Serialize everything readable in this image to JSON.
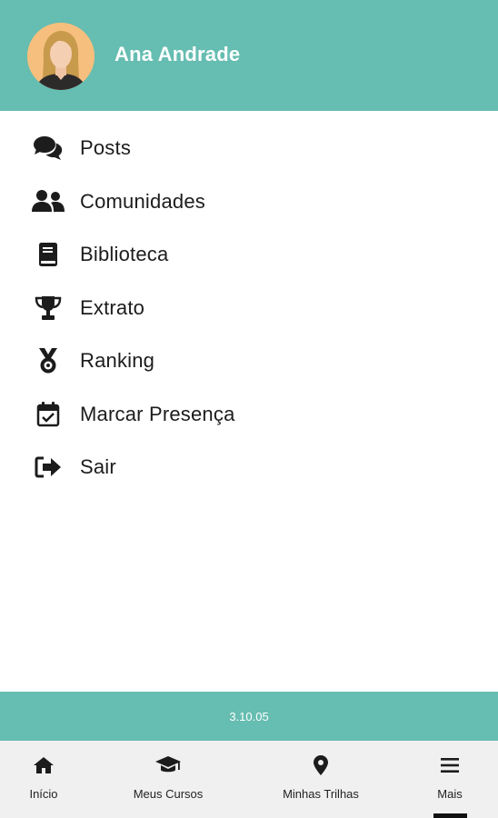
{
  "header": {
    "user_name": "Ana Andrade",
    "avatar_icon": "user-avatar",
    "background_color": "#66bdb1"
  },
  "menu": {
    "items": [
      {
        "label": "Posts",
        "icon": "comments-icon"
      },
      {
        "label": "Comunidades",
        "icon": "users-icon"
      },
      {
        "label": "Biblioteca",
        "icon": "book-icon"
      },
      {
        "label": "Extrato",
        "icon": "trophy-icon"
      },
      {
        "label": "Ranking",
        "icon": "medal-icon"
      },
      {
        "label": "Marcar Presença",
        "icon": "calendar-check-icon"
      },
      {
        "label": "Sair",
        "icon": "sign-out-icon"
      }
    ]
  },
  "footer": {
    "version": "3.10.05"
  },
  "bottom_nav": {
    "tabs": [
      {
        "label": "Início",
        "icon": "home-icon"
      },
      {
        "label": "Meus Cursos",
        "icon": "graduation-cap-icon"
      },
      {
        "label": "Minhas Trilhas",
        "icon": "map-marker-icon"
      },
      {
        "label": "Mais",
        "icon": "menu-icon",
        "active": true
      }
    ]
  }
}
